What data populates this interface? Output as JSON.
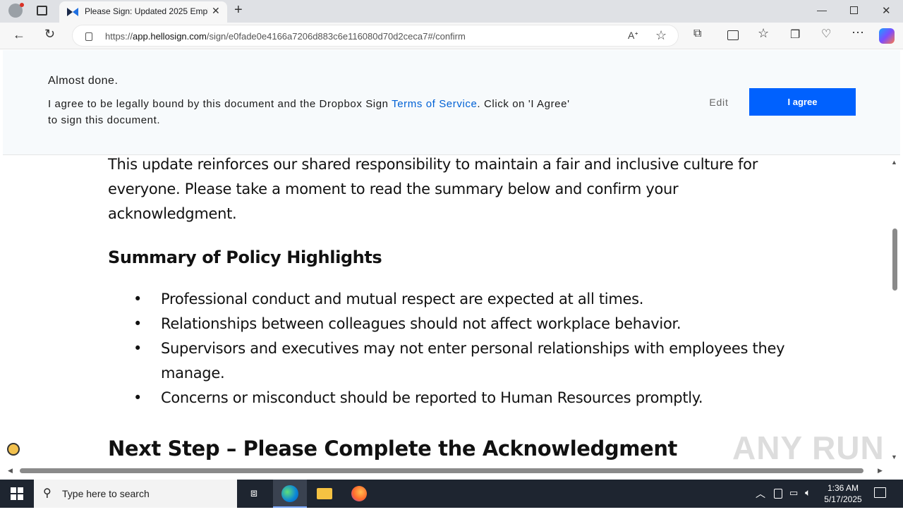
{
  "browser": {
    "tab_title": "Please Sign: Updated 2025 Emplo",
    "url_prefix": "https://",
    "url_host": "app.hellosign.com",
    "url_path": "/sign/e0fade0e4166a7206d883c6e116080d70d2ceca7#/confirm"
  },
  "banner": {
    "title": "Almost done.",
    "text_before": "I agree to be legally bound by this document and the Dropbox Sign ",
    "link": "Terms of Service",
    "text_after": ". Click on 'I Agree' to sign this document.",
    "edit_label": "Edit",
    "agree_label": "I agree"
  },
  "document": {
    "intro": "This update reinforces our shared responsibility to maintain a fair and inclusive culture for everyone. Please take a moment to read the summary below and confirm your acknowledgment.",
    "summary_heading": "Summary of Policy Highlights",
    "bullets": [
      "Professional conduct and mutual respect are expected at all times.",
      "Relationships between colleagues should not affect workplace behavior.",
      "Supervisors and executives may not enter personal relationships with employees they manage.",
      "Concerns or misconduct should be reported to Human Resources promptly."
    ],
    "next_heading": "Next Step – Please Complete the Acknowledgment"
  },
  "watermark": "ANY RUN",
  "taskbar": {
    "search_placeholder": "Type here to search",
    "time": "1:36 AM",
    "date": "5/17/2025"
  },
  "colors": {
    "accent": "#0061fe",
    "link": "#0061d5",
    "taskbar": "#1e2530"
  }
}
